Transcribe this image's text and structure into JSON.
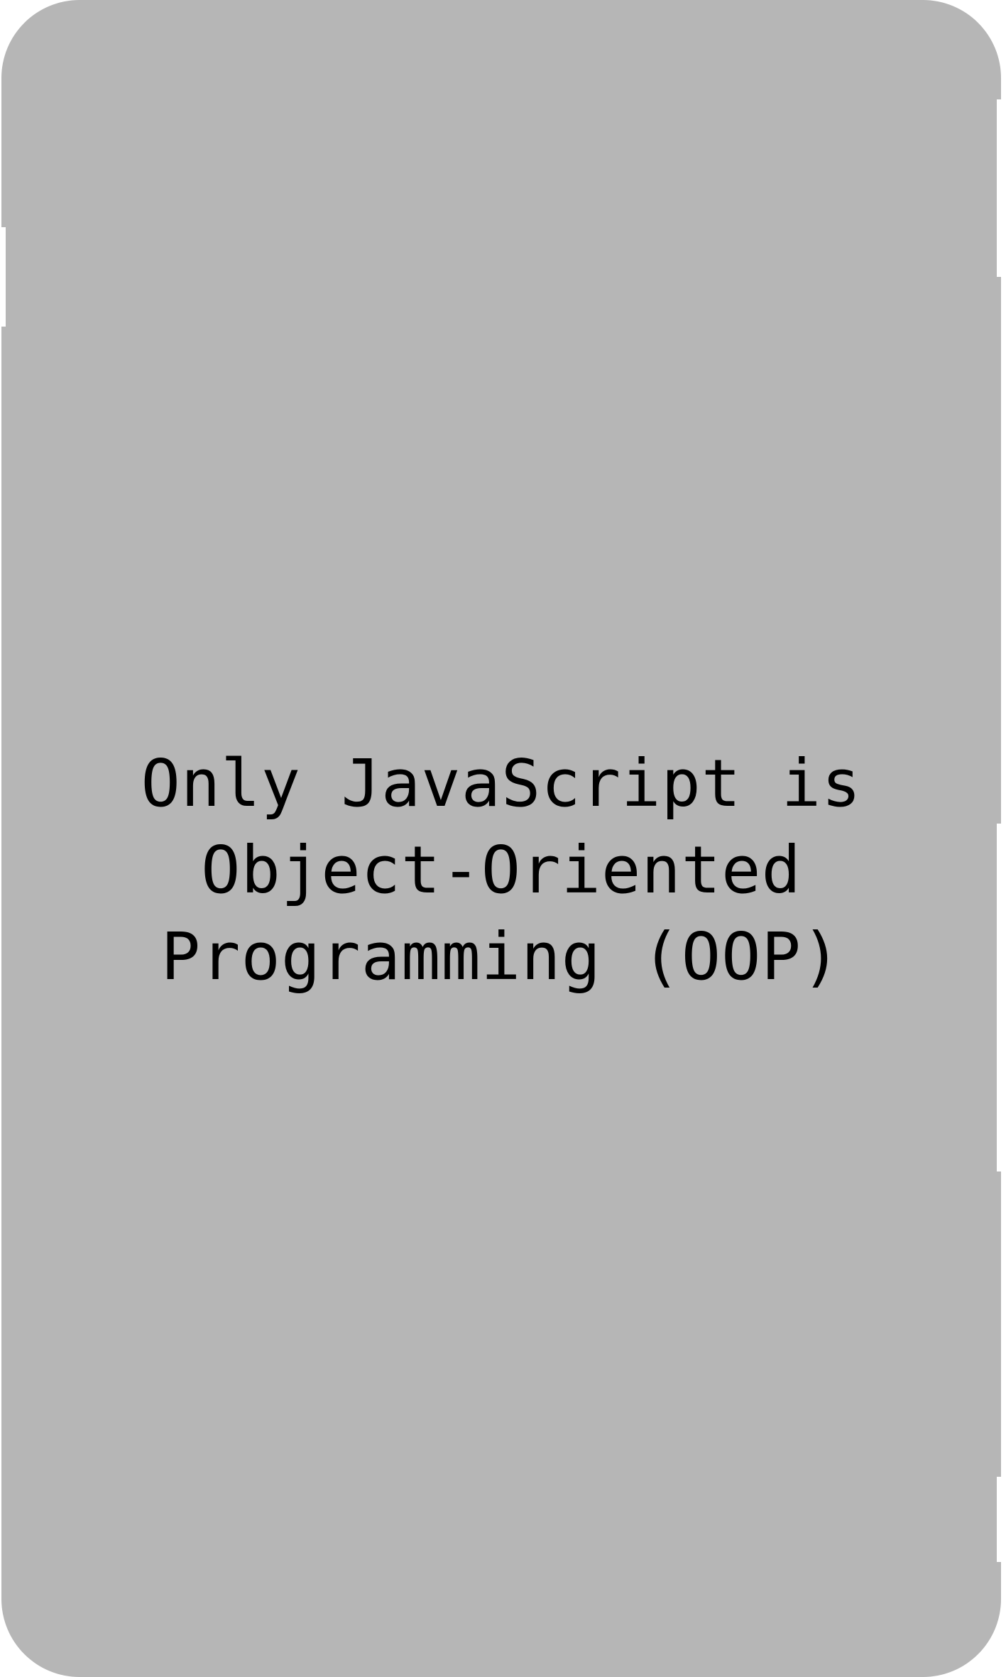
{
  "screen": {
    "background_color": "#b6b6b6",
    "headline": "Only JavaScript is\nObject-Oriented\nProgramming (OOP)"
  }
}
